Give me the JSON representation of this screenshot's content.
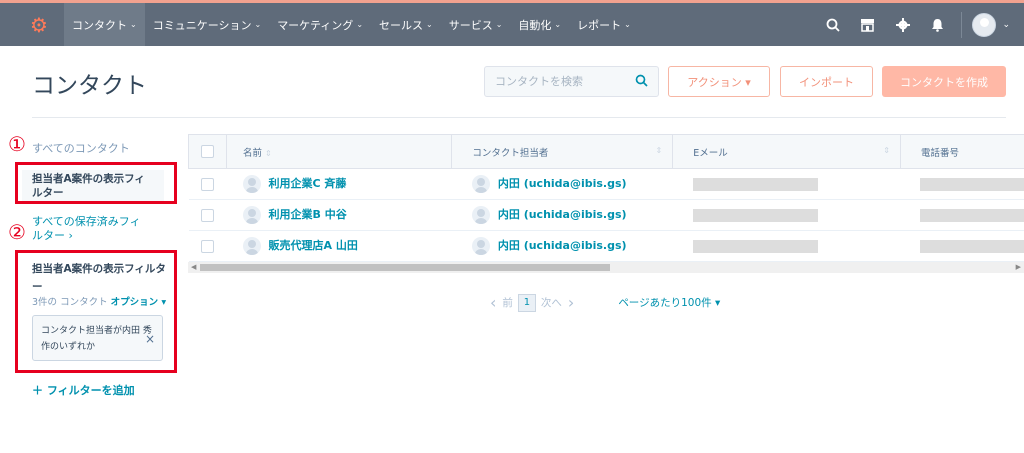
{
  "nav": {
    "logo": "HubSpot",
    "items": [
      {
        "label": "コンタクト",
        "active": true
      },
      {
        "label": "コミュニケーション"
      },
      {
        "label": "マーケティング"
      },
      {
        "label": "セールス"
      },
      {
        "label": "サービス"
      },
      {
        "label": "自動化"
      },
      {
        "label": "レポート"
      }
    ],
    "icons": [
      "search-icon",
      "marketplace-icon",
      "gear-icon",
      "bell-icon",
      "avatar"
    ]
  },
  "header": {
    "title": "コンタクト",
    "search_placeholder": "コンタクトを検索",
    "action_label": "アクション ▾",
    "import_label": "インポート",
    "create_label": "コンタクトを作成"
  },
  "sidebar": {
    "all_contacts": "すべてのコンタクト",
    "current_view": "担当者A案件の表示フィルター",
    "all_saved": "すべての保存済みフィルター ›",
    "filter_title": "担当者A案件の表示フィルター",
    "filter_count": "3件の コンタクト",
    "options_label": "オプション ▾",
    "chip_text": "コンタクト担当者が内田 秀作のいずれか",
    "chip_close": "×",
    "add_filter": "＋ フィルターを追加"
  },
  "annotations": {
    "marker1": "①",
    "marker2": "②"
  },
  "table": {
    "columns": [
      "名前",
      "コンタクト担当者",
      "Eメール",
      "電話番号"
    ],
    "rows": [
      {
        "name": "利用企業C 斉藤",
        "owner": "内田 (uchida@ibis.gs)"
      },
      {
        "name": "利用企業B 中谷",
        "owner": "内田 (uchida@ibis.gs)"
      },
      {
        "name": "販売代理店A 山田",
        "owner": "内田 (uchida@ibis.gs)"
      }
    ]
  },
  "pagination": {
    "prev": "前",
    "page": "1",
    "next": "次へ",
    "per_page": "ページあたり100件 ▾"
  },
  "colors": {
    "topbar": "#5f6b7a",
    "accent": "#ff7a59",
    "link": "#0091ae",
    "highlight": "#e6001f"
  }
}
